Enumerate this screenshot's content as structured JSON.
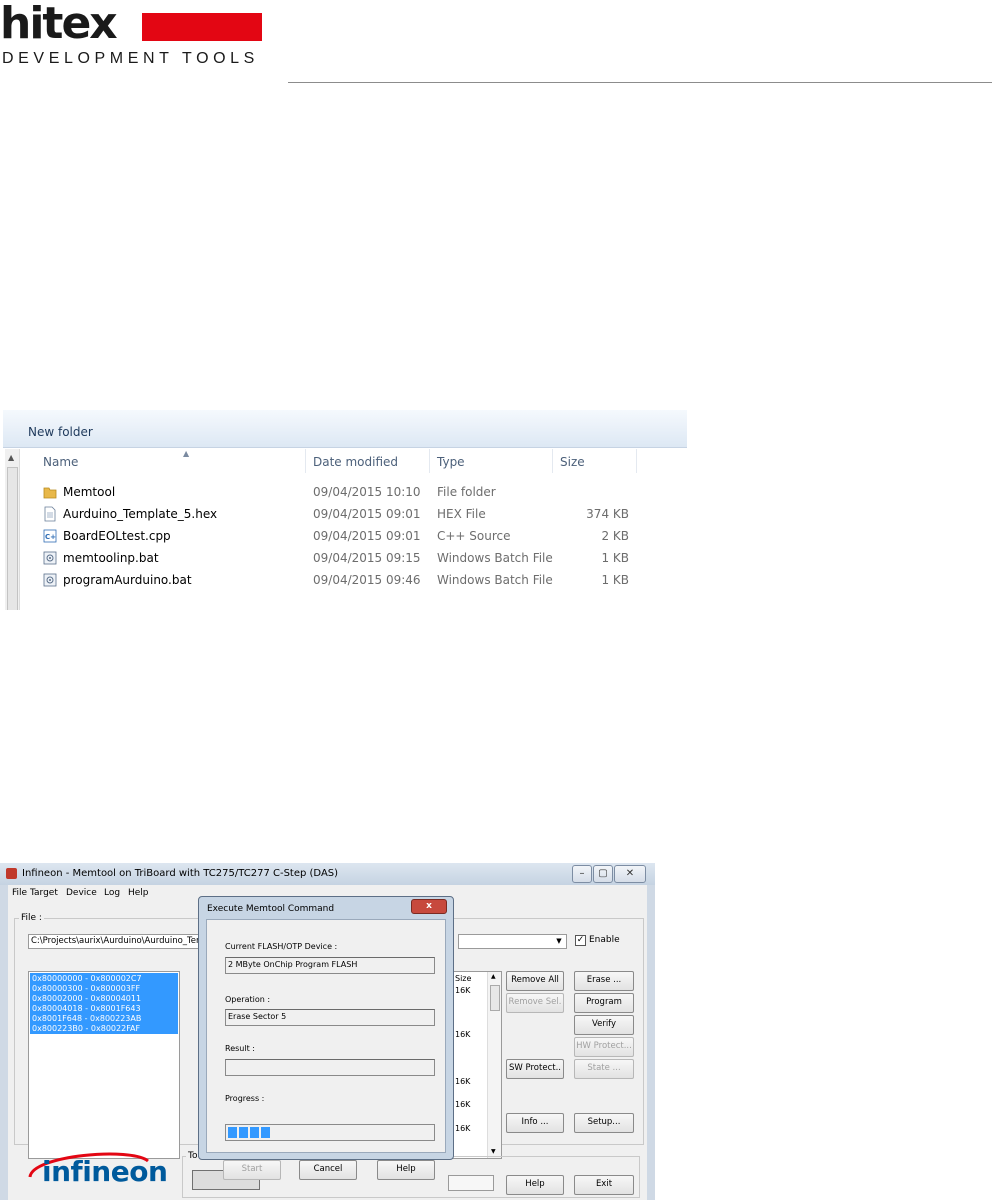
{
  "header": {
    "brand": "hitex",
    "subtitle": "DEVELOPMENT TOOLS",
    "brand_color": "#e30613"
  },
  "explorer": {
    "toolbar": {
      "new_folder": "New folder"
    },
    "columns": [
      "Name",
      "Date modified",
      "Type",
      "Size"
    ],
    "files": [
      {
        "icon": "folder-icon",
        "name": "Memtool",
        "date": "09/04/2015 10:10",
        "type": "File folder",
        "size": ""
      },
      {
        "icon": "hex-file-icon",
        "name": "Aurduino_Template_5.hex",
        "date": "09/04/2015 09:01",
        "type": "HEX File",
        "size": "374 KB"
      },
      {
        "icon": "cpp-file-icon",
        "name": "BoardEOLtest.cpp",
        "date": "09/04/2015 09:01",
        "type": "C++ Source",
        "size": "2 KB"
      },
      {
        "icon": "batch-file-icon",
        "name": "memtoolinp.bat",
        "date": "09/04/2015 09:15",
        "type": "Windows Batch File",
        "size": "1 KB"
      },
      {
        "icon": "batch-file-icon",
        "name": "programAurduino.bat",
        "date": "09/04/2015 09:46",
        "type": "Windows Batch File",
        "size": "1 KB"
      }
    ]
  },
  "memtool": {
    "title": "Infineon - Memtool on TriBoard with TC275/TC277 C-Step (DAS)",
    "menu": [
      "File",
      "Target",
      "Device",
      "Log",
      "Help"
    ],
    "file_group_label": "File :",
    "file_path": "C:\\Projects\\aurix\\Aurduino\\Aurduino_Template",
    "enable_label": "Enable",
    "enable_checked": true,
    "address_ranges": [
      "0x80000000 - 0x800002C7",
      "0x80000300 - 0x800003FF",
      "0x80002000 - 0x80004011",
      "0x80004018 - 0x8001F643",
      "0x8001F648 - 0x800223AB",
      "0x800223B0 - 0x80022FAF"
    ],
    "sector_header": "Size",
    "sector_sizes": [
      "16K",
      "16K",
      "16K",
      "16K",
      "16K"
    ],
    "buttons": {
      "remove_all": "Remove All",
      "remove_sel": "Remove Sel.",
      "sw_protect": "SW Protect..",
      "info": "Info ...",
      "erase": "Erase ...",
      "program": "Program",
      "verify": "Verify",
      "hw_protect": "HW Protect...",
      "state": "State ...",
      "setup": "Setup...",
      "help": "Help",
      "exit": "Exit"
    },
    "tool_group_label": "Too",
    "logo_text": "infineon",
    "dialog": {
      "title": "Execute Memtool Command",
      "close": "x",
      "device_label": "Current FLASH/OTP Device :",
      "device_value": "2 MByte OnChip Program FLASH",
      "operation_label": "Operation :",
      "operation_value": "Erase Sector 5",
      "result_label": "Result :",
      "result_value": "",
      "progress_label": "Progress :",
      "progress_fraction": 0.2,
      "start": "Start",
      "cancel": "Cancel",
      "help": "Help"
    }
  }
}
